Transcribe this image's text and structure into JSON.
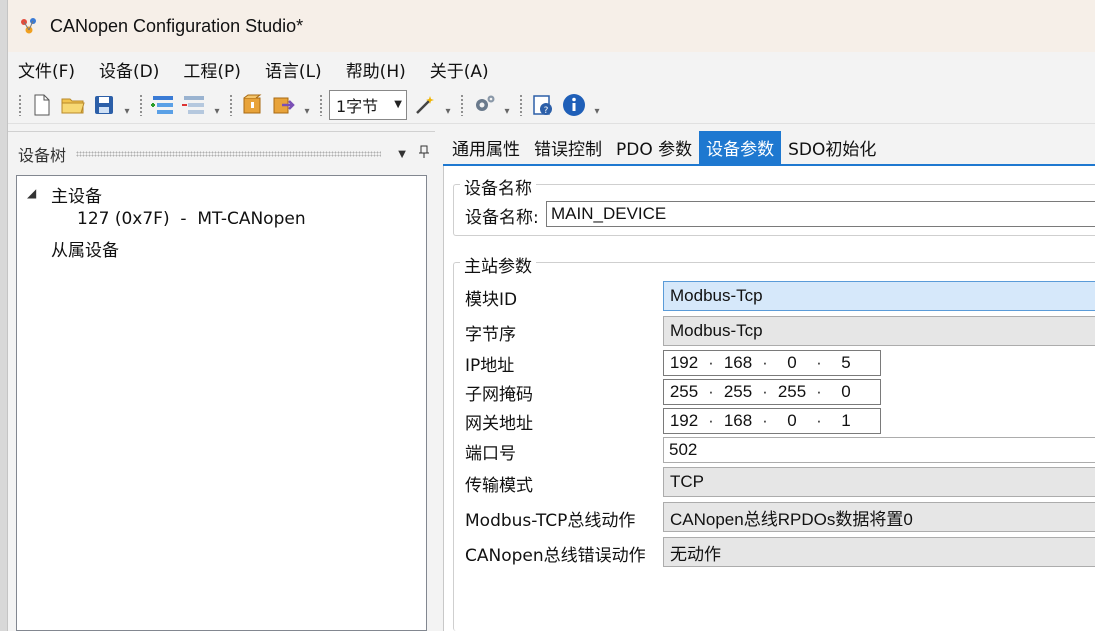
{
  "window": {
    "title": "CANopen Configuration Studio*"
  },
  "menu": {
    "items": [
      "文件(F)",
      "设备(D)",
      "工程(P)",
      "语言(L)",
      "帮助(H)",
      "关于(A)"
    ]
  },
  "toolbar": {
    "byte_select": "1字节"
  },
  "device_tree": {
    "title": "设备树",
    "master_label": "主设备",
    "master_child": "127 (0x7F)  -  MT-CANopen",
    "slave_label": "从属设备"
  },
  "tabs": [
    "通用属性",
    "错误控制",
    "PDO 参数",
    "设备参数",
    "SDO初始化"
  ],
  "active_tab": "设备参数",
  "device_name_group": {
    "title": "设备名称",
    "label": "设备名称:",
    "value": "MAIN_DEVICE"
  },
  "master_params": {
    "title": "主站参数",
    "module_id": {
      "label": "模块ID",
      "value": "Modbus-Tcp"
    },
    "byte_order": {
      "label": "字节序",
      "value": "Modbus-Tcp"
    },
    "ip": {
      "label": "IP地址",
      "octets": [
        "192",
        "168",
        "0",
        "5"
      ]
    },
    "subnet": {
      "label": "子网掩码",
      "octets": [
        "255",
        "255",
        "255",
        "0"
      ]
    },
    "gateway": {
      "label": "网关地址",
      "octets": [
        "192",
        "168",
        "0",
        "1"
      ]
    },
    "port": {
      "label": "端口号",
      "value": "502"
    },
    "transport": {
      "label": "传输模式",
      "value": "TCP"
    },
    "modbus_action": {
      "label": "Modbus-TCP总线动作",
      "value": "CANopen总线RPDOs数据将置0"
    },
    "canopen_action": {
      "label": "CANopen总线错误动作",
      "value": "无动作"
    }
  },
  "colors": {
    "accent": "#1e78d0",
    "titlebar": "#f6efe8",
    "focused_combo": "#d6e8fa"
  }
}
